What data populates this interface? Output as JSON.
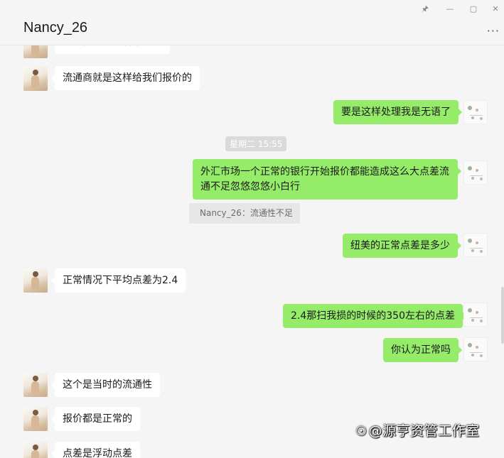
{
  "window": {
    "title": "Nancy_26",
    "pin_icon": "pin-icon",
    "minimize_icon": "minimize-icon",
    "maximize_icon": "maximize-icon",
    "close_icon": "close-icon",
    "more_label": "···"
  },
  "messages": [
    {
      "side": "left",
      "text": "这个我们也控制不了的"
    },
    {
      "side": "left",
      "text": "流通商就是这样给我们报价的"
    },
    {
      "side": "right",
      "text": "要是这样处理我是无语了"
    },
    {
      "side": "right",
      "text": "外汇市场一个正常的银行开始报价都能造成这么大点差流通不足忽悠忽悠小白行"
    },
    {
      "side": "right",
      "text": "纽美的正常点差是多少"
    },
    {
      "side": "left",
      "text": "正常情况下平均点差为2.4"
    },
    {
      "side": "right",
      "text": "2.4那扫我损的时候的350左右的点差"
    },
    {
      "side": "right",
      "text": "你认为正常吗"
    },
    {
      "side": "left",
      "text": "这个是当时的流通性"
    },
    {
      "side": "left",
      "text": "报价都是正常的"
    },
    {
      "side": "left",
      "text": "点差是浮动点差"
    }
  ],
  "timestamp": "星期二 15:55",
  "quote": "Nancy_26：流通性不足",
  "watermark": {
    "icon": "weibo-icon",
    "text": "@源亨资管工作室"
  },
  "colors": {
    "self_bubble": "#95ec69",
    "other_bubble": "#ffffff",
    "background": "#f5f5f5"
  }
}
